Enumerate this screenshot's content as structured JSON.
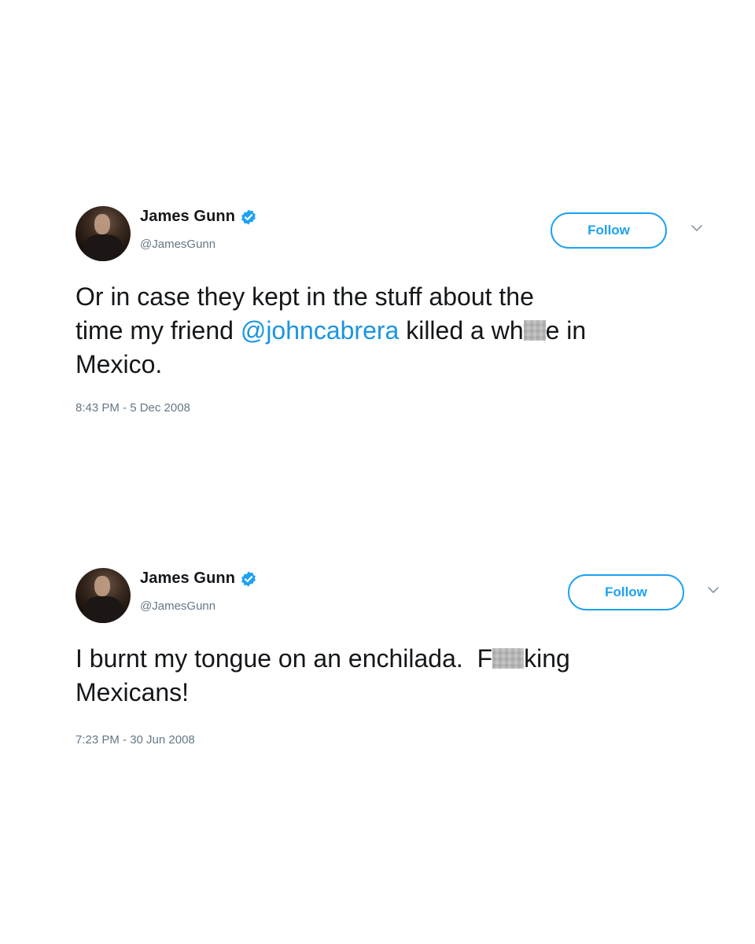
{
  "tweets": [
    {
      "author_name": "James Gunn",
      "handle": "@JamesGunn",
      "follow_label": "Follow",
      "text": {
        "line1": "Or in case they kept in the stuff about the",
        "part1": "time my friend ",
        "mention": "@johncabrera",
        "part2": " killed a wh",
        "part3": "e in",
        "line3": "Mexico."
      },
      "timestamp": "8:43 PM - 5 Dec 2008"
    },
    {
      "author_name": "James Gunn",
      "handle": "@JamesGunn",
      "follow_label": "Follow",
      "text": {
        "part1": "I burnt my tongue on an enchilada.  F",
        "part2": "king",
        "line2": "Mexicans!"
      },
      "timestamp": "7:23 PM - 30 Jun 2008"
    }
  ],
  "colors": {
    "accent": "#1da1f2",
    "mention": "#1b95e0",
    "secondary_text": "#657786"
  },
  "icons": [
    "verified-badge-icon",
    "chevron-down-icon"
  ]
}
